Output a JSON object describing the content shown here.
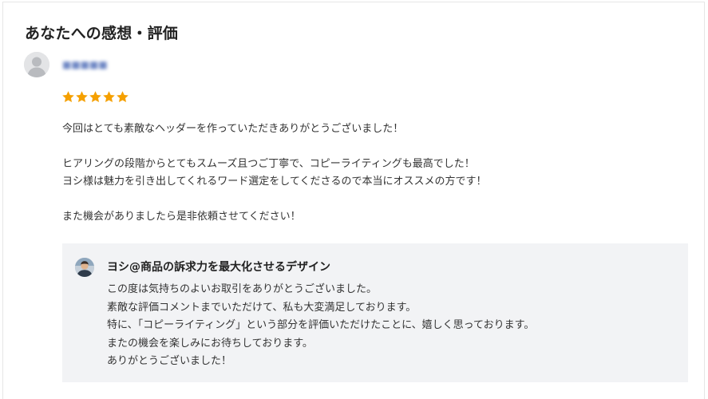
{
  "section": {
    "title": "あなたへの感想・評価"
  },
  "reviewer": {
    "name": "■■■■■"
  },
  "rating": {
    "value": 5,
    "max": 5,
    "star_color": "#f5a000"
  },
  "review": {
    "paragraphs": [
      "今回はとても素敵なヘッダーを作っていただきありがとうございました！",
      "",
      "ヒアリングの段階からとてもスムーズ且つご丁寧で、コピーライティングも最高でした！",
      "ヨシ様は魅力を引き出してくれるワード選定をしてくださるので本当にオススメの方です！",
      "",
      "また機会がありましたら是非依頼させてください！"
    ]
  },
  "reply": {
    "seller_name": "ヨシ@商品の訴求力を最大化させるデザイン",
    "lines": [
      "この度は気持ちのよいお取引をありがとうございました。",
      "素敵な評価コメントまでいただけて、私も大変満足しております。",
      "特に、「コピーライティング」という部分を評価いただけたことに、嬉しく思っております。",
      "またの機会を楽しみにお待ちしております。",
      "ありがとうございました！"
    ],
    "background_color": "#f2f3f5"
  }
}
